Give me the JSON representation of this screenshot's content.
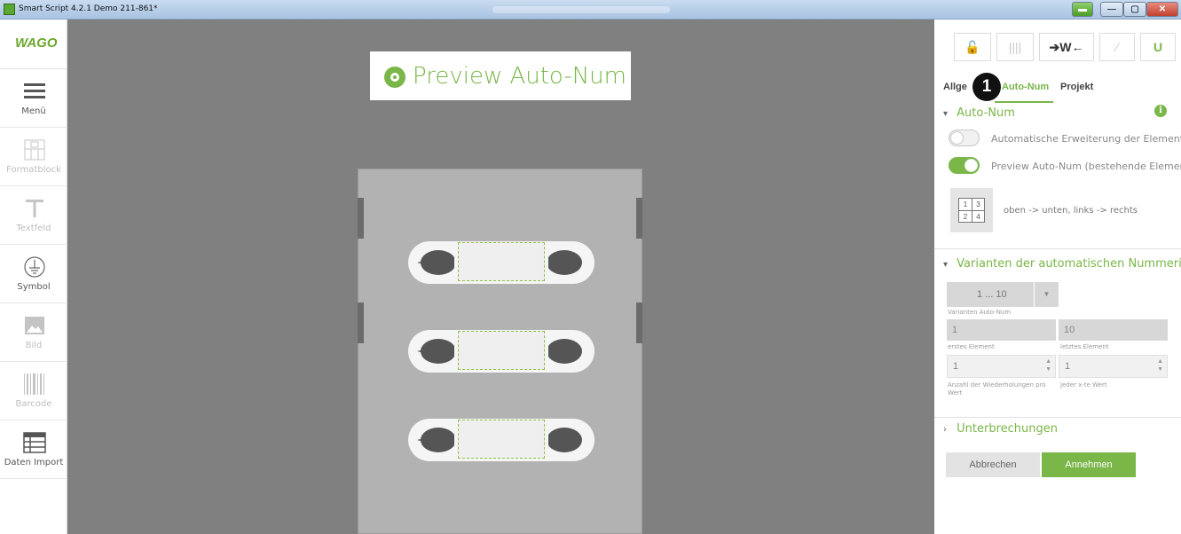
{
  "window": {
    "title": "Smart Script 4.2.1  Demo 211-861*",
    "controls": [
      "▬",
      "—",
      "▢",
      "✕"
    ]
  },
  "sidebar": {
    "logo": "WAGO",
    "items": [
      {
        "label": "Menü",
        "icon": "hamburger-menu-icon",
        "enabled": true
      },
      {
        "label": "Formatblock",
        "icon": "formatblock-icon",
        "enabled": false
      },
      {
        "label": "Textfeld",
        "icon": "text-icon",
        "enabled": false
      },
      {
        "label": "Symbol",
        "icon": "ground-symbol-icon",
        "enabled": true
      },
      {
        "label": "Bild",
        "icon": "image-icon",
        "enabled": false
      },
      {
        "label": "Barcode",
        "icon": "barcode-icon",
        "enabled": false
      },
      {
        "label": "Daten Import",
        "icon": "table-import-icon",
        "enabled": true
      }
    ]
  },
  "canvas": {
    "preview_banner": "Preview Auto-Num"
  },
  "panel": {
    "toolbar_icons": [
      "unlock-icon",
      "columns-icon",
      "wrap-arrows-icon",
      "magic-wand-icon",
      "magnet-icon"
    ],
    "toolbar_glyphs": [
      "🔓",
      "||||",
      "➔W←",
      "⁄",
      "U"
    ],
    "tabs": {
      "allg": "Allge",
      "autonum": "Auto-Num",
      "projekt": "Projekt"
    },
    "marker": "1",
    "autonum_section": {
      "title": "Auto-Num",
      "info_glyph": "i",
      "toggle_expand_label": "Automatische Erweiterung der Elemente",
      "toggle_expand_on": false,
      "toggle_preview_label": "Preview Auto-Num (bestehende Elemente)",
      "toggle_preview_on": true,
      "order_grid": [
        "1",
        "3",
        "2",
        "4"
      ],
      "order_label": "oben -> unten, links -> rechts"
    },
    "variants_section": {
      "title": "Varianten der automatischen Nummerierung",
      "select_value": "1 ... 10",
      "select_caption": "Varianten Auto-Num",
      "first_value": "1",
      "first_caption": "erstes Element",
      "last_value": "10",
      "last_caption": "letztes Element",
      "repeat_value": "1",
      "repeat_caption_1": "Anzahl der Wiederholungen pro",
      "repeat_caption_2": "Wert",
      "nth_value": "1",
      "nth_caption": "Jeder x-te Wert"
    },
    "interrupts_section": {
      "title": "Unterbrechungen"
    },
    "buttons": {
      "cancel": "Abbrechen",
      "accept": "Annehmen"
    }
  },
  "colors": {
    "accent": "#7ab648",
    "canvas_bg": "#808080",
    "label_bg": "#b2b2b2"
  }
}
